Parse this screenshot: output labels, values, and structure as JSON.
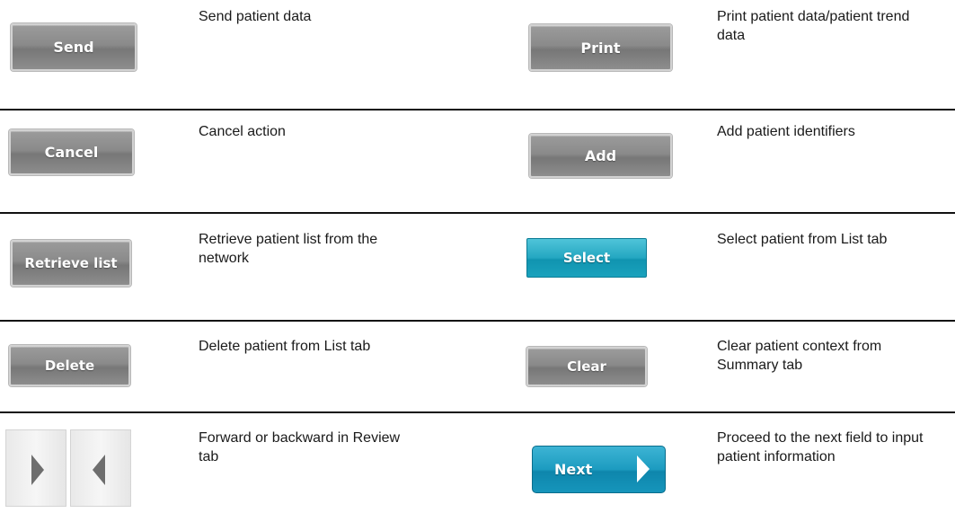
{
  "rows": [
    {
      "left": {
        "button": "Send",
        "description": "Send patient data"
      },
      "right": {
        "button": "Print",
        "description": "Print patient data/patient trend data"
      }
    },
    {
      "left": {
        "button": "Cancel",
        "description": "Cancel action"
      },
      "right": {
        "button": "Add",
        "description": "Add patient identifiers"
      }
    },
    {
      "left": {
        "button": "Retrieve list",
        "description": "Retrieve patient list from the network"
      },
      "right": {
        "button": "Select",
        "description": "Select patient from List tab"
      }
    },
    {
      "left": {
        "button": "Delete",
        "description": "Delete patient from List tab"
      },
      "right": {
        "button": "Clear",
        "description": "Clear patient context from Summary tab"
      }
    },
    {
      "left": {
        "button": "",
        "icons": [
          "right-arrow-icon",
          "left-arrow-icon"
        ],
        "description": "Forward or backward in Review tab"
      },
      "right": {
        "button": "Next",
        "icon": "right-arrow-icon",
        "description": "Proceed to the next field to input patient information"
      }
    }
  ],
  "colors": {
    "gray_button": "#8a8a8a",
    "teal_button": "#1aa2bd",
    "rule": "#111111"
  }
}
